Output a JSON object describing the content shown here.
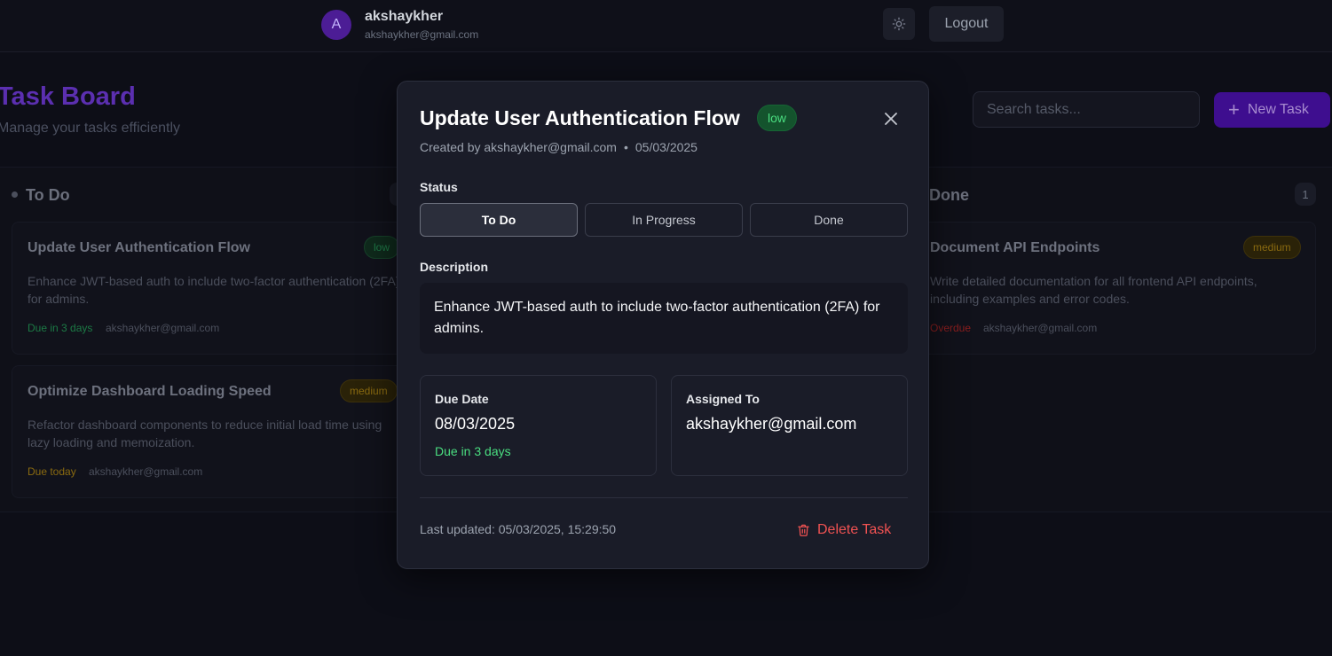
{
  "header": {
    "avatar_initial": "A",
    "user_name": "akshaykher",
    "user_email": "akshaykher@gmail.com",
    "theme_icon": "sun-icon",
    "logout_label": "Logout"
  },
  "board": {
    "title": "Task Board",
    "subtitle": "Manage your tasks efficiently",
    "search_placeholder": "Search tasks...",
    "new_task_label": "New Task"
  },
  "columns": {
    "todo": {
      "title": "To Do",
      "cards": [
        {
          "title": "Update User Authentication Flow",
          "priority": "low",
          "description": "Enhance JWT-based auth to include two-factor authentication (2FA) for admins.",
          "due": "Due in 3 days",
          "assignee": "akshaykher@gmail.com"
        },
        {
          "title": "Optimize Dashboard Loading Speed",
          "priority": "medium",
          "description": "Refactor dashboard components to reduce initial load time using lazy loading and memoization.",
          "due": "Due today",
          "assignee": "akshaykher@gmail.com"
        }
      ]
    },
    "done": {
      "title": "Done",
      "count": "1",
      "cards": [
        {
          "title": "Document API Endpoints",
          "priority": "medium",
          "description": "Write detailed documentation for all frontend API endpoints, including examples and error codes.",
          "due": "Overdue",
          "assignee": "akshaykher@gmail.com"
        }
      ]
    }
  },
  "modal": {
    "title": "Update User Authentication Flow",
    "priority": "low",
    "created_by": "Created by akshaykher@gmail.com",
    "separator": "•",
    "created_date": "05/03/2025",
    "status_label": "Status",
    "status_options": [
      "To Do",
      "In Progress",
      "Done"
    ],
    "status_selected": "To Do",
    "description_label": "Description",
    "description": "Enhance JWT-based auth to include two-factor authentication (2FA) for admins.",
    "due_label": "Due Date",
    "due_date": "08/03/2025",
    "due_hint": "Due in 3 days",
    "assigned_label": "Assigned To",
    "assigned_to": "akshaykher@gmail.com",
    "last_updated": "Last updated: 05/03/2025, 15:29:50",
    "delete_label": "Delete Task"
  },
  "colors": {
    "accent": "#5b21b6",
    "low": "#4ade80",
    "medium": "#a16207",
    "danger": "#f05252",
    "overdue": "#9b1c1c"
  }
}
